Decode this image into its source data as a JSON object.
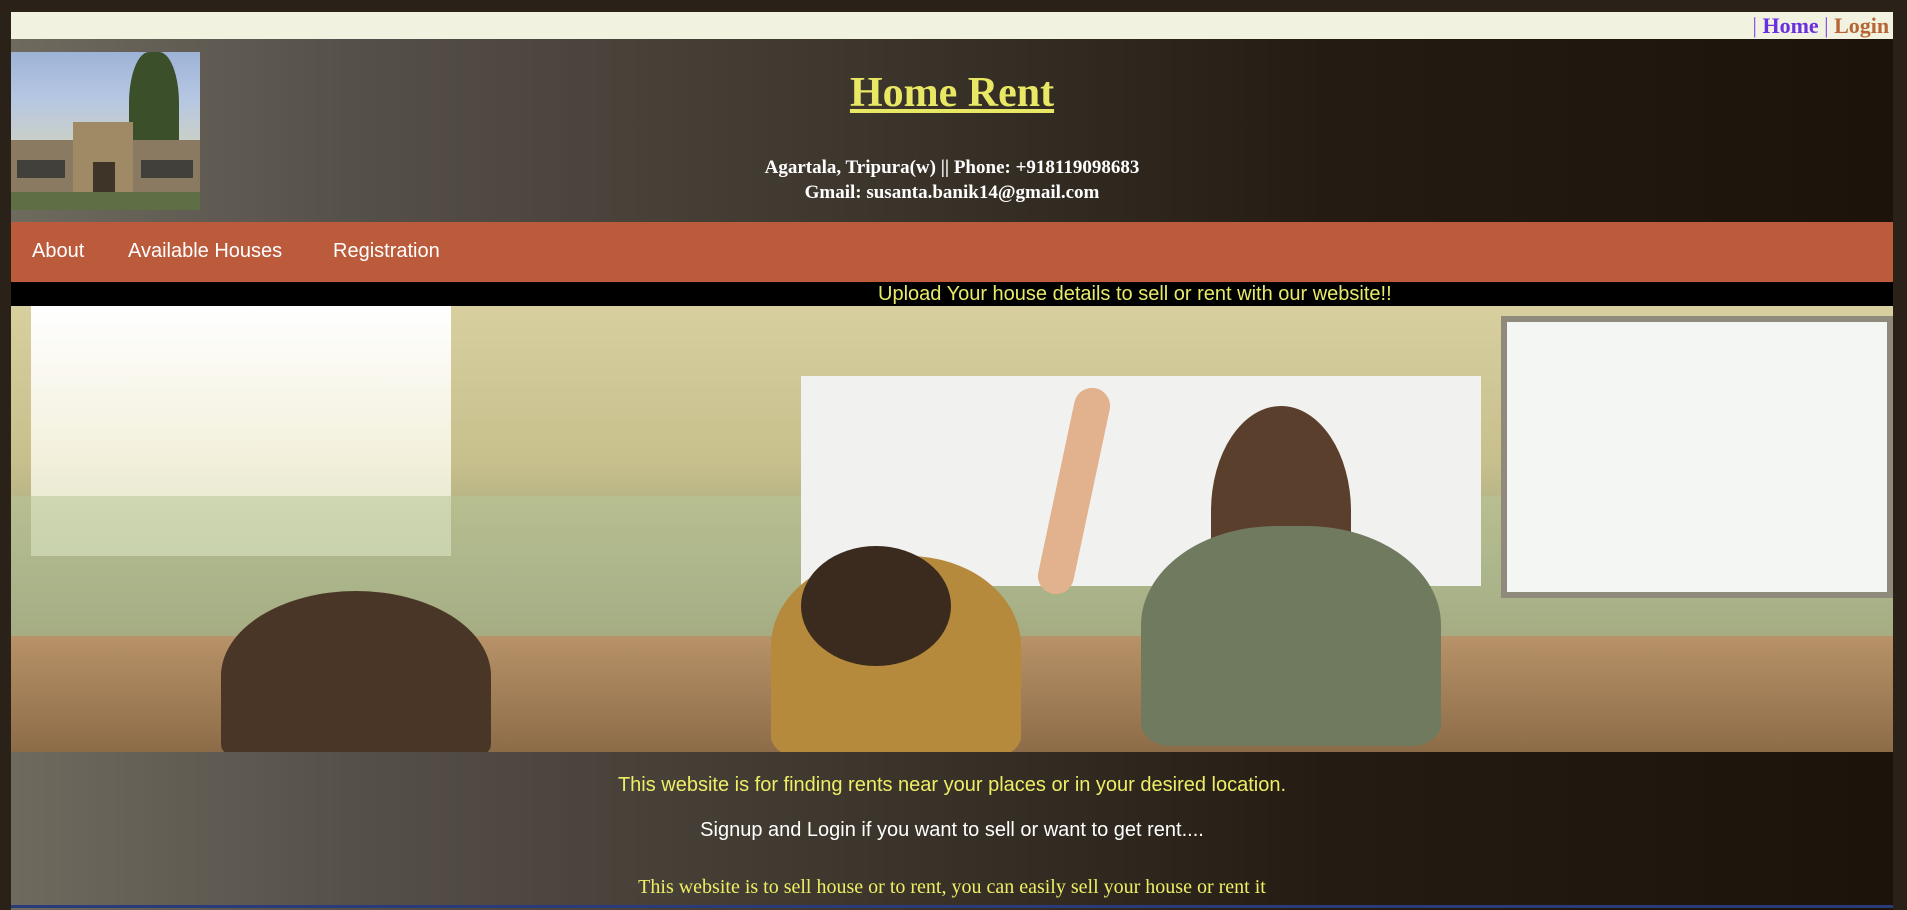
{
  "topbar": {
    "sep": "|",
    "home": "Home",
    "login": "Login"
  },
  "header": {
    "title": "Home Rent",
    "address_line": "Agartala, Tripura(w) || Phone: +918119098683",
    "email_line": "Gmail: susanta.banik14@gmail.com"
  },
  "nav": {
    "items": [
      "About",
      "Available Houses",
      "Registration"
    ]
  },
  "strip": {
    "text": "Upload Your house details to sell or rent with our website!!"
  },
  "main": {
    "p1": "This website is for finding rents near your places or in your desired location.",
    "p2": "Signup and Login if you want to sell or want to get rent....",
    "p3": "This website is to sell house or to rent, you can easily sell your house or rent it"
  },
  "colors": {
    "nav_bg": "#bb5b3b",
    "title": "#e8e865",
    "home_link": "#6a2fe0",
    "login_link": "#b86535"
  }
}
